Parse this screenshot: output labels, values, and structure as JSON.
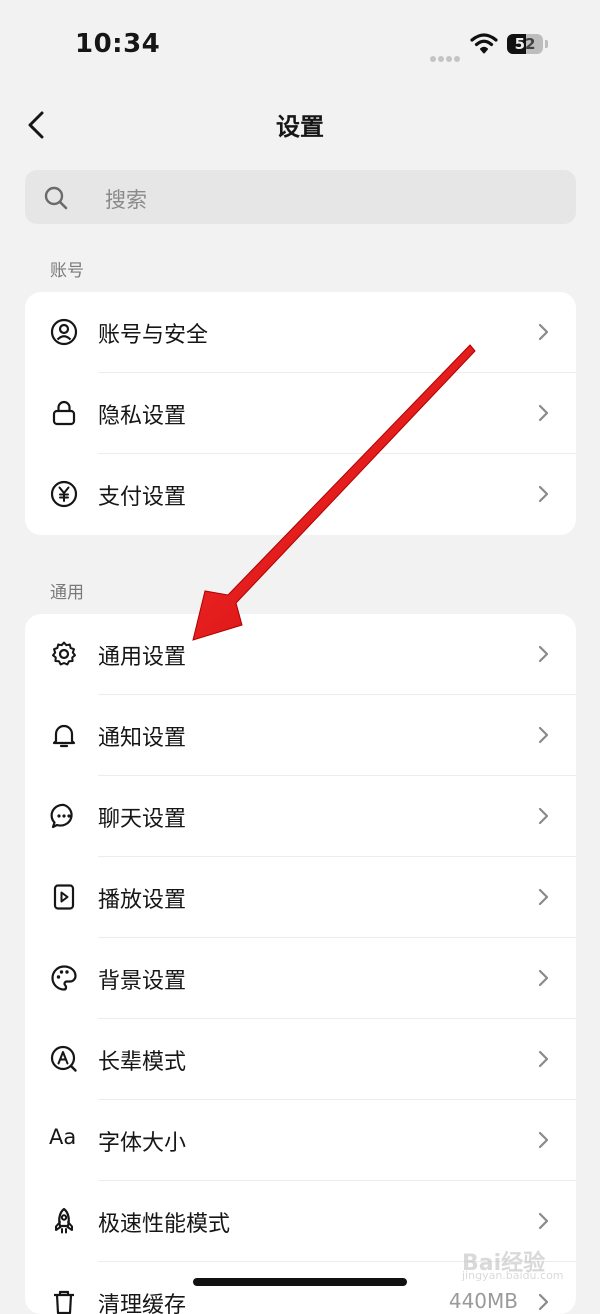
{
  "status_bar": {
    "time": "10:34",
    "battery": "52",
    "battery_level": 0.52
  },
  "nav": {
    "title": "设置"
  },
  "search": {
    "placeholder": "搜索"
  },
  "sections": {
    "account": {
      "label": "账号",
      "items": [
        {
          "label": "账号与安全",
          "icon": "user-circle-icon"
        },
        {
          "label": "隐私设置",
          "icon": "lock-icon"
        },
        {
          "label": "支付设置",
          "icon": "yen-circle-icon"
        }
      ]
    },
    "general": {
      "label": "通用",
      "items": [
        {
          "label": "通用设置",
          "icon": "gear-icon"
        },
        {
          "label": "通知设置",
          "icon": "bell-icon"
        },
        {
          "label": "聊天设置",
          "icon": "chat-bubble-icon"
        },
        {
          "label": "播放设置",
          "icon": "play-square-icon"
        },
        {
          "label": "背景设置",
          "icon": "palette-icon"
        },
        {
          "label": "长辈模式",
          "icon": "elder-mode-icon"
        },
        {
          "label": "字体大小",
          "icon": "font-size-icon"
        },
        {
          "label": "极速性能模式",
          "icon": "rocket-icon"
        },
        {
          "label": "清理缓存",
          "icon": "trash-icon",
          "value": "440MB"
        }
      ]
    }
  },
  "annotation": {
    "type": "red-arrow",
    "target": "general-settings"
  },
  "watermark": {
    "text": "Bai经验",
    "sub": "jingyan.baidu.com"
  },
  "colors": {
    "background": "#f2f2f2",
    "card": "#ffffff",
    "arrow": "#e01010"
  }
}
